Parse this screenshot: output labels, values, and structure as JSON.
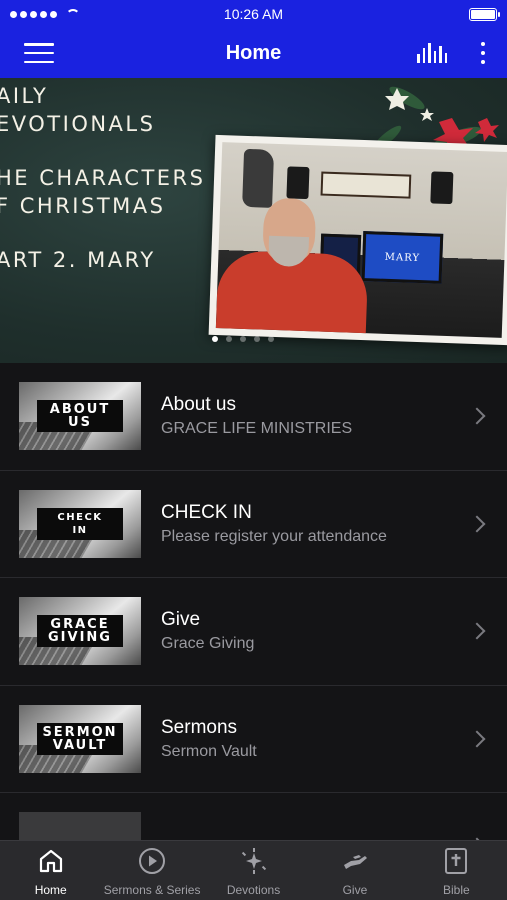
{
  "status_bar": {
    "time": "10:26 AM"
  },
  "nav": {
    "title": "Home"
  },
  "hero": {
    "lines": [
      "AILY",
      "EVOTIONALS",
      "HE CHARACTERS",
      "F CHRISTMAS",
      "ART 2. MARY"
    ],
    "monitor_text": "MARY",
    "slide_count": 5,
    "active_slide": 1
  },
  "list": {
    "items": [
      {
        "thumb_label": "ABOUT\nUS",
        "title": "About us",
        "subtitle": "GRACE LIFE MINISTRIES"
      },
      {
        "thumb_label": "CHECK\nIN",
        "title": "CHECK IN",
        "subtitle": "Please register your attendance"
      },
      {
        "thumb_label": "GRACE\nGIVING",
        "title": "Give",
        "subtitle": "Grace Giving"
      },
      {
        "thumb_label": "SERMON\nVAULT",
        "title": "Sermons",
        "subtitle": "Sermon Vault"
      }
    ]
  },
  "tabs": [
    {
      "label": "Home",
      "icon": "home-icon",
      "active": true
    },
    {
      "label": "Sermons & Series",
      "icon": "play-circle-icon",
      "active": false
    },
    {
      "label": "Devotions",
      "icon": "sparkle-icon",
      "active": false
    },
    {
      "label": "Give",
      "icon": "hand-icon",
      "active": false
    },
    {
      "label": "Bible",
      "icon": "bible-icon",
      "active": false
    }
  ],
  "colors": {
    "brand_blue": "#1a22e0",
    "list_bg": "#141416",
    "tab_bg": "#2a2a2d"
  }
}
